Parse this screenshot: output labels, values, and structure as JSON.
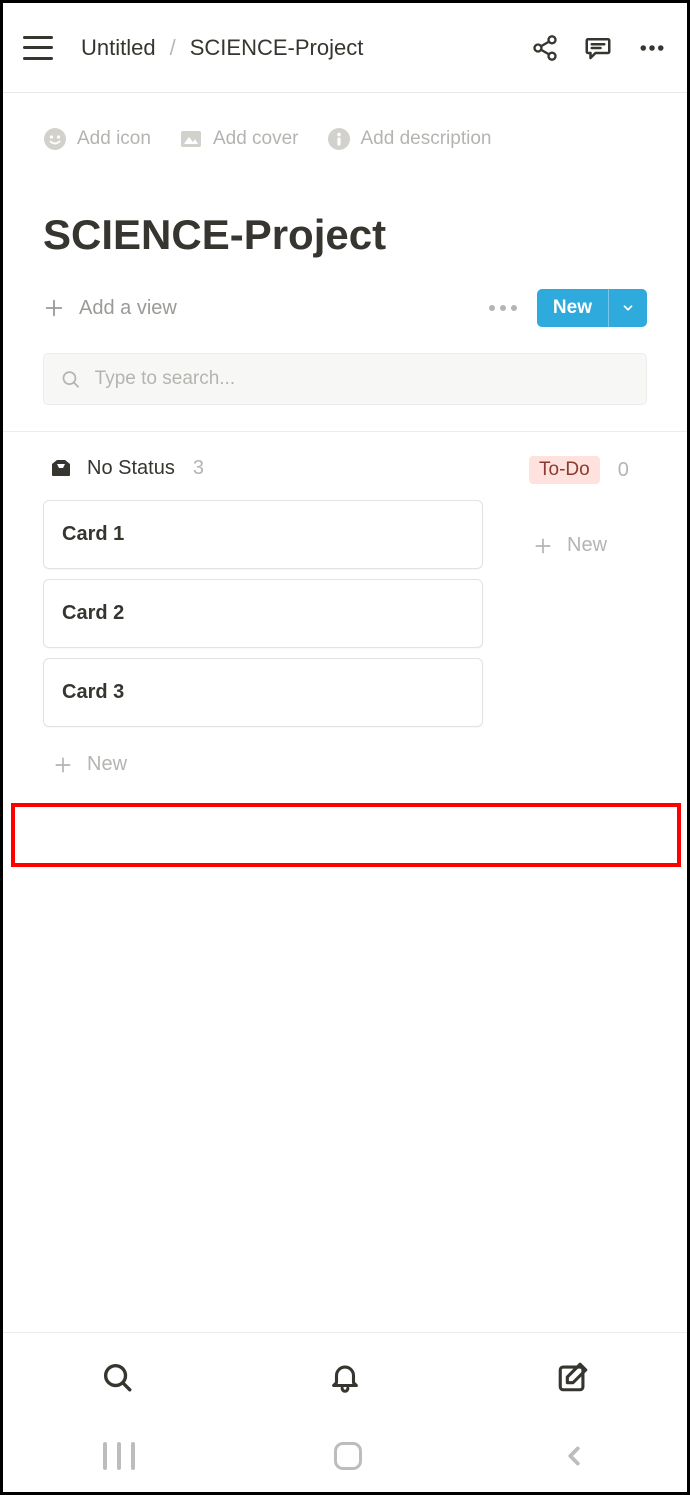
{
  "topbar": {
    "breadcrumb": {
      "parent": "Untitled",
      "current": "SCIENCE-Project"
    }
  },
  "page_actions": {
    "add_icon": "Add icon",
    "add_cover": "Add cover",
    "add_description": "Add description"
  },
  "page": {
    "title": "SCIENCE-Project"
  },
  "viewbar": {
    "add_view": "Add a view",
    "new_label": "New"
  },
  "search": {
    "placeholder": "Type to search..."
  },
  "board": {
    "columns": [
      {
        "name": "No Status",
        "count": "3",
        "cards": [
          "Card 1",
          "Card 2",
          "Card 3"
        ],
        "new_label": "New"
      },
      {
        "name": "To-Do",
        "count": "0",
        "cards": [],
        "new_label": "New"
      }
    ]
  }
}
